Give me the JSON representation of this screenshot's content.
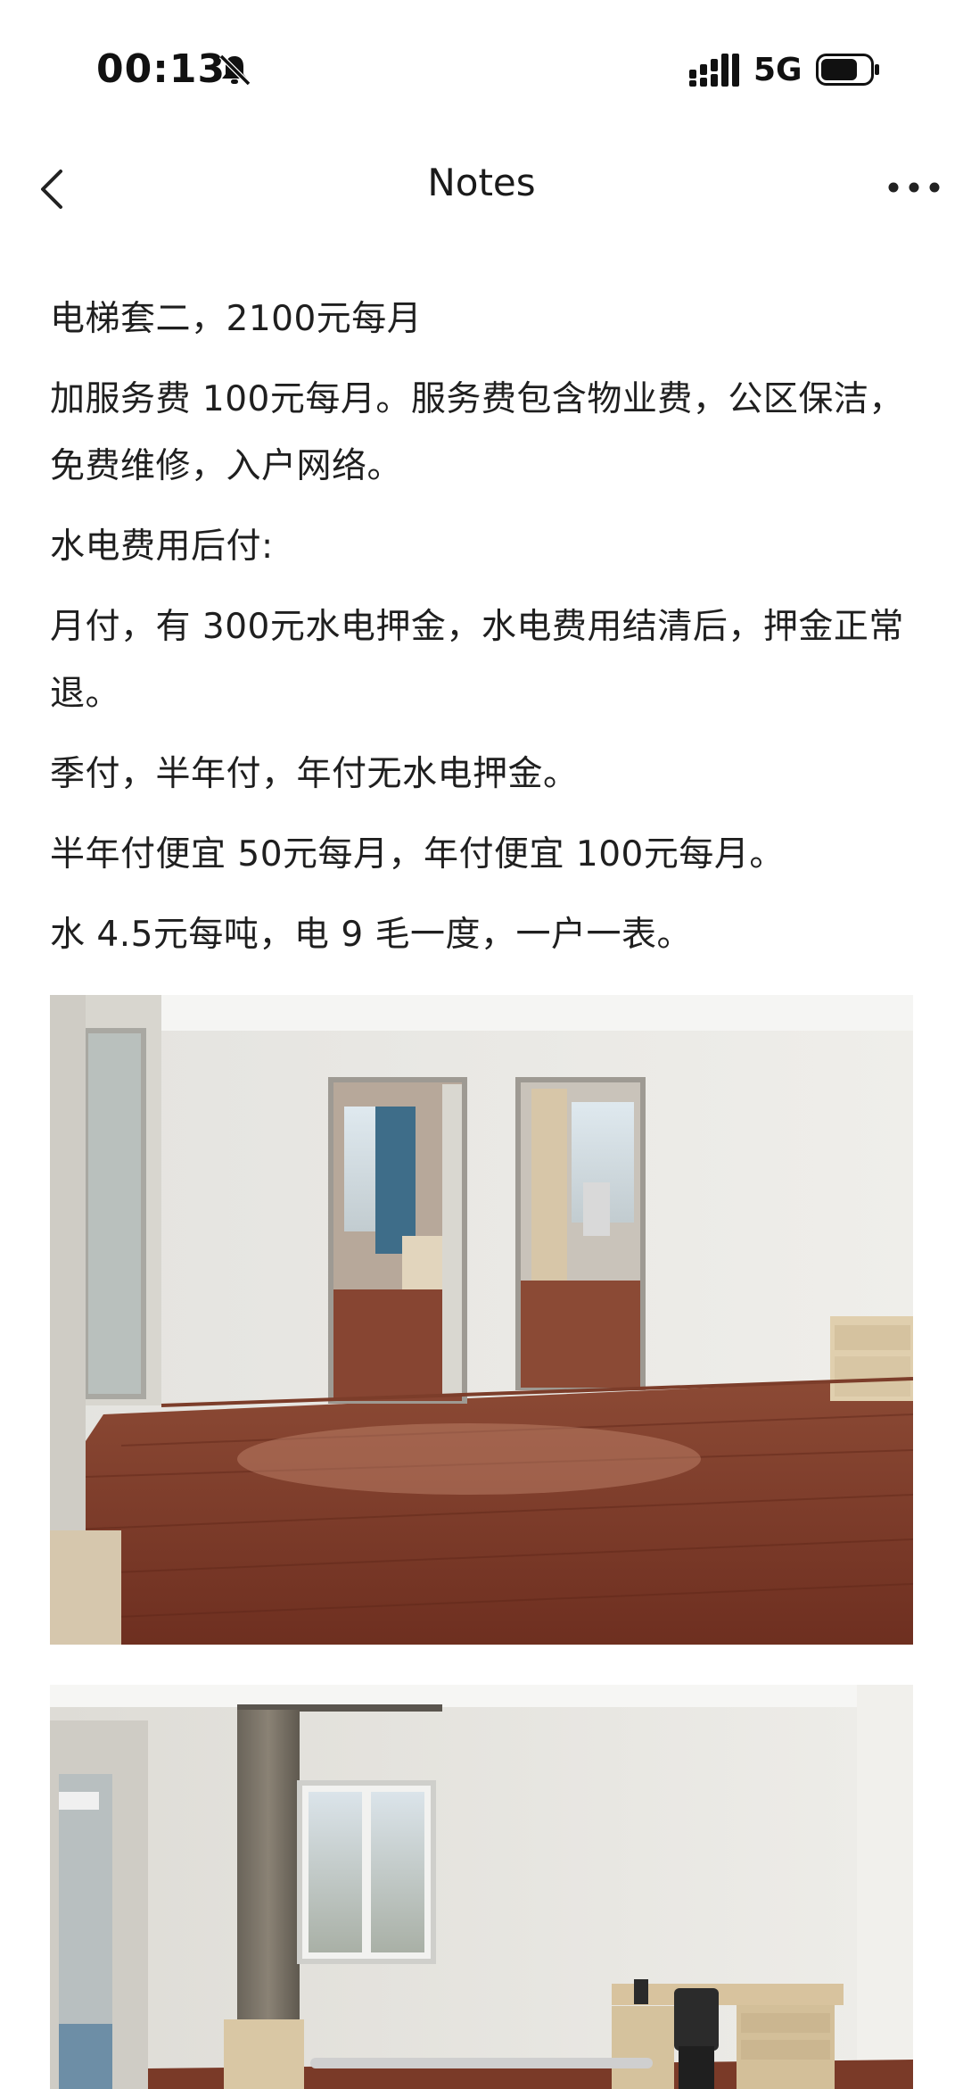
{
  "status_bar": {
    "time": "00:13",
    "network": "5G",
    "icons": [
      "bell-muted-icon",
      "signal-icon",
      "battery-icon"
    ]
  },
  "header": {
    "title": "Notes",
    "back_icon": "chevron-left-icon",
    "more_icon": "more-horizontal-icon"
  },
  "note": {
    "lines": [
      "电梯套二，2100元每月",
      "加服务费 100元每月。服务费包含物业费，公区保洁，免费维修，入户网络。",
      "水电费用后付:",
      "月付，有 300元水电押金，水电费用结清后，押金正常退。",
      "季付，半年付，年付无水电押金。",
      "半年付便宜 50元每月，年付便宜 100元每月。",
      "水 4.5元每吨，电 9 毛一度，一户一表。"
    ]
  },
  "photos": [
    {
      "name": "living-room-photo"
    },
    {
      "name": "bedroom-photo"
    }
  ],
  "colors": {
    "background": "#ffffff",
    "text": "#1f1f1f",
    "floor": "#7a3a28",
    "wall": "#ecebe7"
  }
}
